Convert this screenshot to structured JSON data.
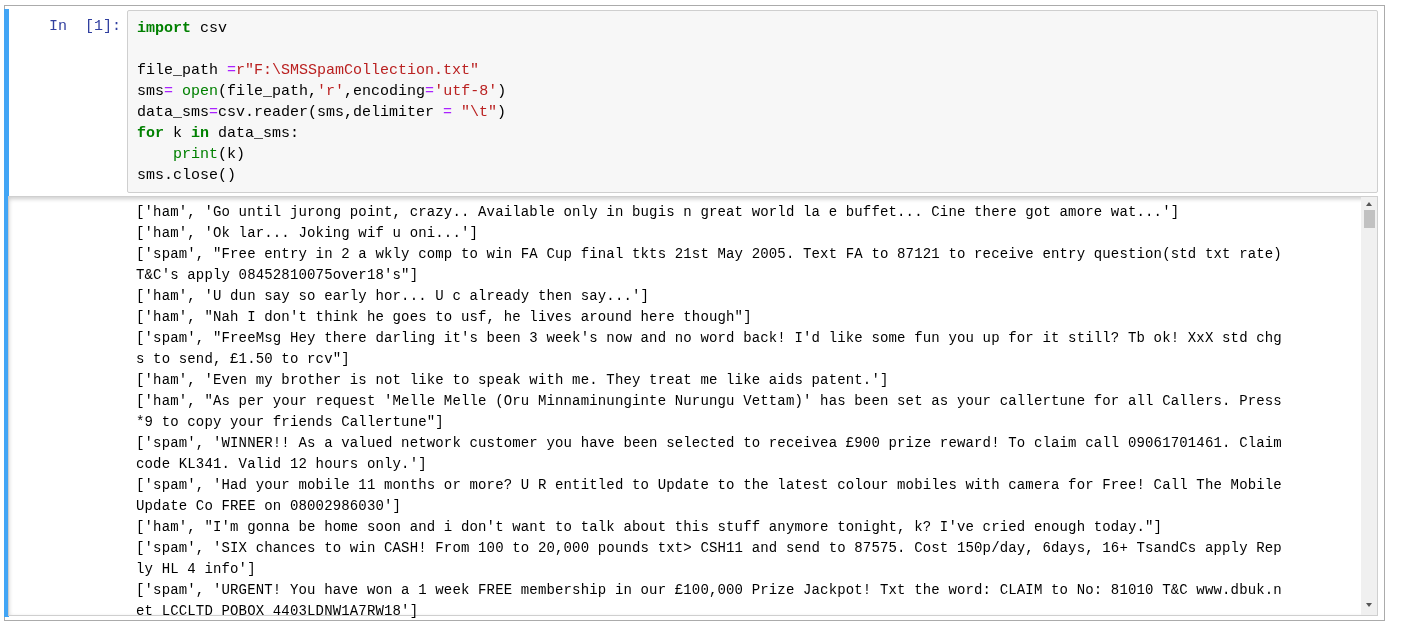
{
  "cell": {
    "prompt": "In  [1]:",
    "selected": true,
    "code": [
      {
        "tokens": [
          {
            "text": "import",
            "kind": "keyword"
          },
          {
            "text": " csv",
            "kind": "plain"
          }
        ]
      },
      {
        "gap_before": true,
        "tokens": [
          {
            "text": "file_path ",
            "kind": "plain"
          },
          {
            "text": "=",
            "kind": "operator"
          },
          {
            "text": "r\"F:\\SMSSpamCollection.txt\"",
            "kind": "string"
          }
        ]
      },
      {
        "tokens": [
          {
            "text": "sms",
            "kind": "plain"
          },
          {
            "text": "= ",
            "kind": "operator"
          },
          {
            "text": "open",
            "kind": "builtin"
          },
          {
            "text": "(file_path,",
            "kind": "plain"
          },
          {
            "text": "'r'",
            "kind": "string"
          },
          {
            "text": ",encoding",
            "kind": "plain"
          },
          {
            "text": "=",
            "kind": "operator"
          },
          {
            "text": "'utf-8'",
            "kind": "string"
          },
          {
            "text": ")",
            "kind": "plain"
          }
        ]
      },
      {
        "tokens": [
          {
            "text": "data_sms",
            "kind": "plain"
          },
          {
            "text": "=",
            "kind": "operator"
          },
          {
            "text": "csv.reader(sms,delimiter ",
            "kind": "plain"
          },
          {
            "text": "= ",
            "kind": "operator"
          },
          {
            "text": "\"\\t\"",
            "kind": "string"
          },
          {
            "text": ")",
            "kind": "plain"
          }
        ]
      },
      {
        "tokens": [
          {
            "text": "for",
            "kind": "keyword"
          },
          {
            "text": " k ",
            "kind": "plain"
          },
          {
            "text": "in",
            "kind": "keyword"
          },
          {
            "text": " data_sms:",
            "kind": "plain"
          }
        ]
      },
      {
        "tokens": [
          {
            "text": "    print",
            "kind": "builtin"
          },
          {
            "text": "(k)",
            "kind": "plain"
          }
        ]
      },
      {
        "tokens": [
          {
            "text": "sms.close()",
            "kind": "plain"
          }
        ]
      }
    ],
    "output": [
      "['ham', 'Go until jurong point, crazy.. Available only in bugis n great world la e buffet... Cine there got amore wat...']",
      "['ham', 'Ok lar... Joking wif u oni...']",
      "['spam', \"Free entry in 2 a wkly comp to win FA Cup final tkts 21st May 2005. Text FA to 87121 to receive entry question(std txt rate)",
      "T&C's apply 08452810075over18's\"]",
      "['ham', 'U dun say so early hor... U c already then say...']",
      "['ham', \"Nah I don't think he goes to usf, he lives around here though\"]",
      "['spam', \"FreeMsg Hey there darling it's been 3 week's now and no word back! I'd like some fun you up for it still? Tb ok! XxX std chg",
      "s to send, £1.50 to rcv\"]",
      "['ham', 'Even my brother is not like to speak with me. They treat me like aids patent.']",
      "['ham', \"As per your request 'Melle Melle (Oru Minnaminunginte Nurungu Vettam)' has been set as your callertune for all Callers. Press",
      "*9 to copy your friends Callertune\"]",
      "['spam', 'WINNER!! As a valued network customer you have been selected to receivea £900 prize reward! To claim call 09061701461. Claim",
      "code KL341. Valid 12 hours only.']",
      "['spam', 'Had your mobile 11 months or more? U R entitled to Update to the latest colour mobiles with camera for Free! Call The Mobile",
      "Update Co FREE on 08002986030']",
      "['ham', \"I'm gonna be home soon and i don't want to talk about this stuff anymore tonight, k? I've cried enough today.\"]",
      "['spam', 'SIX chances to win CASH! From 100 to 20,000 pounds txt> CSH11 and send to 87575. Cost 150p/day, 6days, 16+ TsandCs apply Rep",
      "ly HL 4 info']",
      "['spam', 'URGENT! You have won a 1 week FREE membership in our £100,000 Prize Jackpot! Txt the word: CLAIM to No: 81010 T&C www.dbuk.n",
      "et LCCLTD POBOX 4403LDNW1A7RW18']"
    ]
  }
}
